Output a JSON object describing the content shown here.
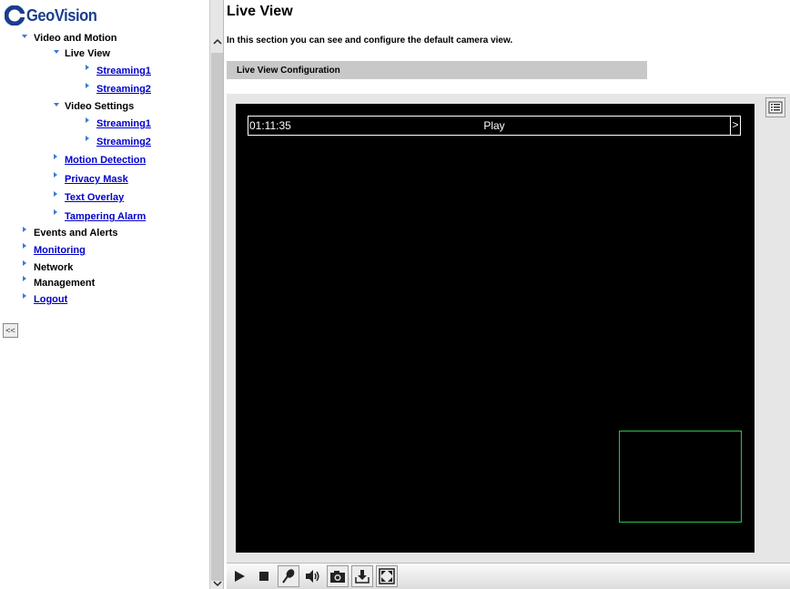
{
  "brand": {
    "name": "GeoVision",
    "color": "#1a3e8c"
  },
  "sidebar": {
    "video_and_motion": "Video and Motion",
    "live_view": "Live View",
    "live_view_streaming1": "Streaming1",
    "live_view_streaming2": "Streaming2",
    "video_settings": "Video Settings",
    "video_settings_streaming1": "Streaming1",
    "video_settings_streaming2": "Streaming2",
    "motion_detection": "Motion Detection",
    "privacy_mask": "Privacy Mask",
    "text_overlay": "Text Overlay",
    "tampering_alarm": "Tampering Alarm",
    "events_and_alerts": "Events and Alerts",
    "monitoring": "Monitoring",
    "network": "Network",
    "management": "Management",
    "logout": "Logout",
    "collapse_label": "<<"
  },
  "main": {
    "title": "Live View",
    "description": "In this section you can see and configure the default camera view.",
    "section_title": "Live View Configuration"
  },
  "video": {
    "timestamp": "01:11:35",
    "status": "Play",
    "next_label": ">"
  },
  "toolbar": {
    "icons": [
      "play-icon",
      "stop-icon",
      "microphone-icon",
      "speaker-icon",
      "camera-icon",
      "download-icon",
      "fullscreen-icon"
    ]
  },
  "colors": {
    "link": "#0000cc",
    "arrow": "#3a7bd5",
    "motion_region": "#2ebf4a"
  }
}
